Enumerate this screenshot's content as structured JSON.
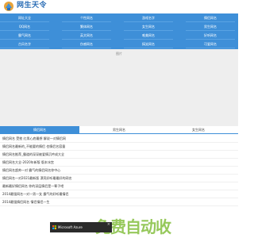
{
  "header": {
    "logo_text": "网生天令",
    "logo_icon": "site-logo-icon"
  },
  "nav": {
    "rows": [
      [
        "网址大全",
        "个性网名",
        "游戏名字",
        "情侣网名"
      ],
      [
        "QQ网名",
        "繁体网名",
        "女生网名",
        "男生网名"
      ],
      [
        "霸气网名",
        "英文网名",
        "唯美网名",
        "好听网名"
      ],
      [
        "古风名字",
        "伤感网名",
        "搞笑网名",
        "可爱网名"
      ]
    ]
  },
  "banner": {
    "placeholder": "图片"
  },
  "tabs": [
    {
      "label": "情侣网名",
      "active": true
    },
    {
      "label": "男生网名",
      "active": false
    },
    {
      "label": "女生网名",
      "active": false
    }
  ],
  "list": [
    {
      "text": "情侣网名 受挫 红男心底最想 解说一对情侣网",
      "time": ""
    },
    {
      "text": "情侣网名最新的_不能要的情侣 也情侣名容量",
      "time": ""
    },
    {
      "text": "情侣网名推荐_霸道的深深被爱情沉吟成大全",
      "time": ""
    },
    {
      "text": "情侣网名大全-2020年新版 版本冰宫",
      "time": ""
    },
    {
      "text": "情侣网名超帅一对 霸气的情侣网名你中心",
      "time": ""
    },
    {
      "text": "情侣网名一对2021最新版 漂亮好听最最好的网名",
      "time": ""
    },
    {
      "text": "最新最好情侣网名 你的深层情侣是一辈子吧",
      "time": ""
    },
    {
      "text": "2014最强网名一对一男一女 霸气的好听最情侣",
      "time": ""
    },
    {
      "text": "2014最强情侣网名 情侣情侣一生",
      "time": ""
    }
  ],
  "watermark": "免费自动收",
  "ad": {
    "text": "Microsoft Azure",
    "close": "×"
  },
  "colors": {
    "primary": "#3e8fd8",
    "banner_bg": "#eeeeee",
    "watermark": "#8bc34a"
  }
}
